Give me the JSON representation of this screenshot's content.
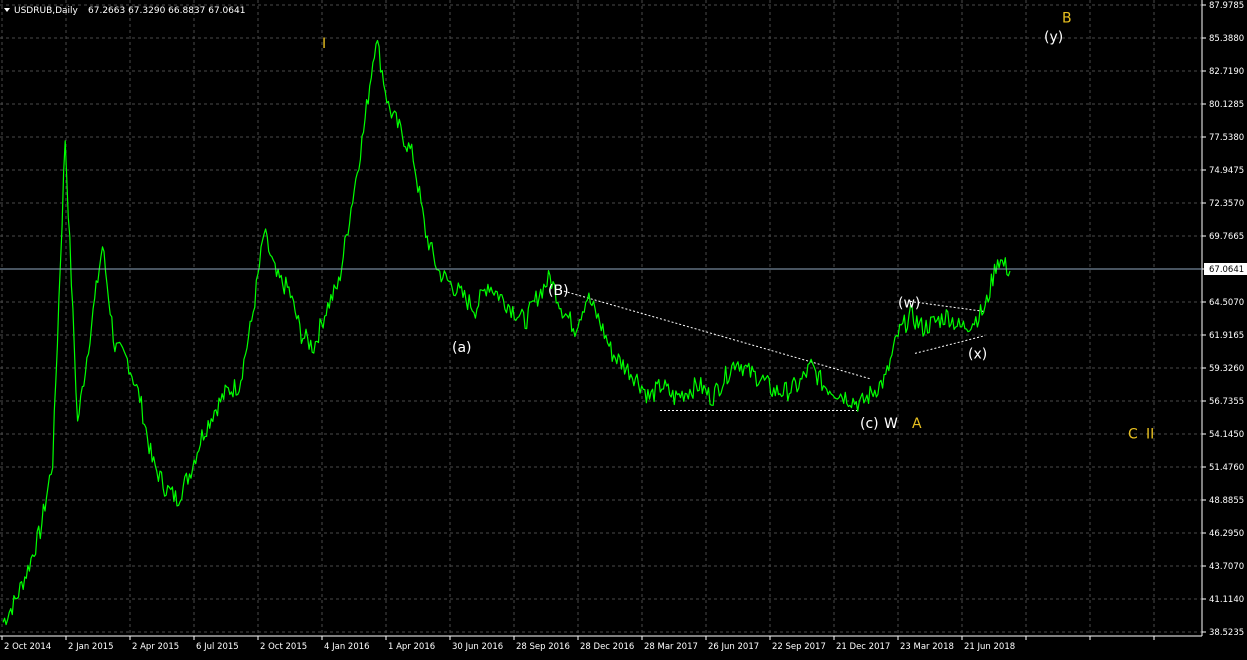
{
  "window": {
    "symbol_label": "USDRUB,Daily",
    "ohlc_label": "67.2663 67.3290 66.8837 67.0641"
  },
  "colors": {
    "background": "#000000",
    "grid": "#4a4a4a",
    "price_line": "#00ff00",
    "axis_text": "#ffffff",
    "current_price_line": "#8fa8c0",
    "wave_label_white": "#ffffff",
    "wave_label_yellow": "#e8c020"
  },
  "chart_data": {
    "type": "line",
    "symbol": "USDRUB",
    "timeframe": "Daily",
    "ylim": [
      38.525,
      87.9785
    ],
    "grid": true,
    "y_ticks": [
      "87.9785",
      "85.3880",
      "82.7190",
      "80.1285",
      "77.5380",
      "74.9475",
      "72.3570",
      "69.7665",
      "67.0641",
      "64.5070",
      "61.9165",
      "59.3260",
      "56.7355",
      "54.1450",
      "51.4760",
      "48.8855",
      "46.2950",
      "43.7070",
      "41.1140",
      "38.5235"
    ],
    "x_ticks": [
      "2 Oct 2014",
      "2 Jan 2015",
      "2 Apr 2015",
      "6 Jul 2015",
      "2 Oct 2015",
      "4 Jan 2016",
      "1 Apr 2016",
      "30 Jun 2016",
      "28 Sep 2016",
      "28 Dec 2016",
      "28 Mar 2017",
      "26 Jun 2017",
      "22 Sep 2017",
      "21 Dec 2017",
      "23 Mar 2018",
      "21 Jun 2018"
    ],
    "current_price": 67.0641,
    "series": [
      {
        "values": [
          39.3,
          41.0,
          43.5,
          46.5,
          52.0,
          77.5,
          55.0,
          62.0,
          69.0,
          61.0,
          60.0,
          57.0,
          52.0,
          50.0,
          49.0,
          51.0,
          54.0,
          56.0,
          57.5,
          58.0,
          63.0,
          70.0,
          66.5,
          65.5,
          62.0,
          61.0,
          64.0,
          66.0,
          72.0,
          78.0,
          85.5,
          80.0,
          78.0,
          76.0,
          70.0,
          67.0,
          66.0,
          65.0,
          64.0,
          66.0,
          65.0,
          64.0,
          63.0,
          65.0,
          66.5,
          64.0,
          62.5,
          65.0,
          63.0,
          60.5,
          59.5,
          58.5,
          57.0,
          58.0,
          57.0,
          57.5,
          58.0,
          57.0,
          58.5,
          60.0,
          59.0,
          58.5,
          57.5,
          57.5,
          58.0,
          59.5,
          58.0,
          57.5,
          57.0,
          56.5,
          57.5,
          58.5,
          62.0,
          63.5,
          62.5,
          63.0,
          63.5,
          62.5,
          63.0,
          64.0,
          68.0,
          67.0
        ]
      }
    ],
    "annotations": [
      {
        "text": "I",
        "value": 85.0,
        "color": "yellow"
      },
      {
        "text": "(B)",
        "value": 65.5,
        "color": "white"
      },
      {
        "text": "(a)",
        "value": 61.0,
        "color": "white"
      },
      {
        "text": "(w)",
        "value": 64.5,
        "color": "white"
      },
      {
        "text": "(x)",
        "value": 60.5,
        "color": "white"
      },
      {
        "text": "(c)",
        "value": 55.0,
        "color": "white"
      },
      {
        "text": "W",
        "value": 55.0,
        "color": "white"
      },
      {
        "text": "A",
        "value": 55.0,
        "color": "yellow"
      },
      {
        "text": "(y)",
        "value": 85.5,
        "color": "white"
      },
      {
        "text": "B",
        "value": 87.0,
        "color": "yellow"
      },
      {
        "text": "C",
        "value": 54.2,
        "color": "yellow"
      },
      {
        "text": "II",
        "value": 54.2,
        "color": "yellow"
      }
    ],
    "trendlines": [
      {
        "from": 65.5,
        "to": 58.5
      },
      {
        "from": 56.0,
        "to": 56.0
      },
      {
        "from": 64.6,
        "to": 63.8
      },
      {
        "from": 60.5,
        "to": 61.9
      }
    ]
  }
}
